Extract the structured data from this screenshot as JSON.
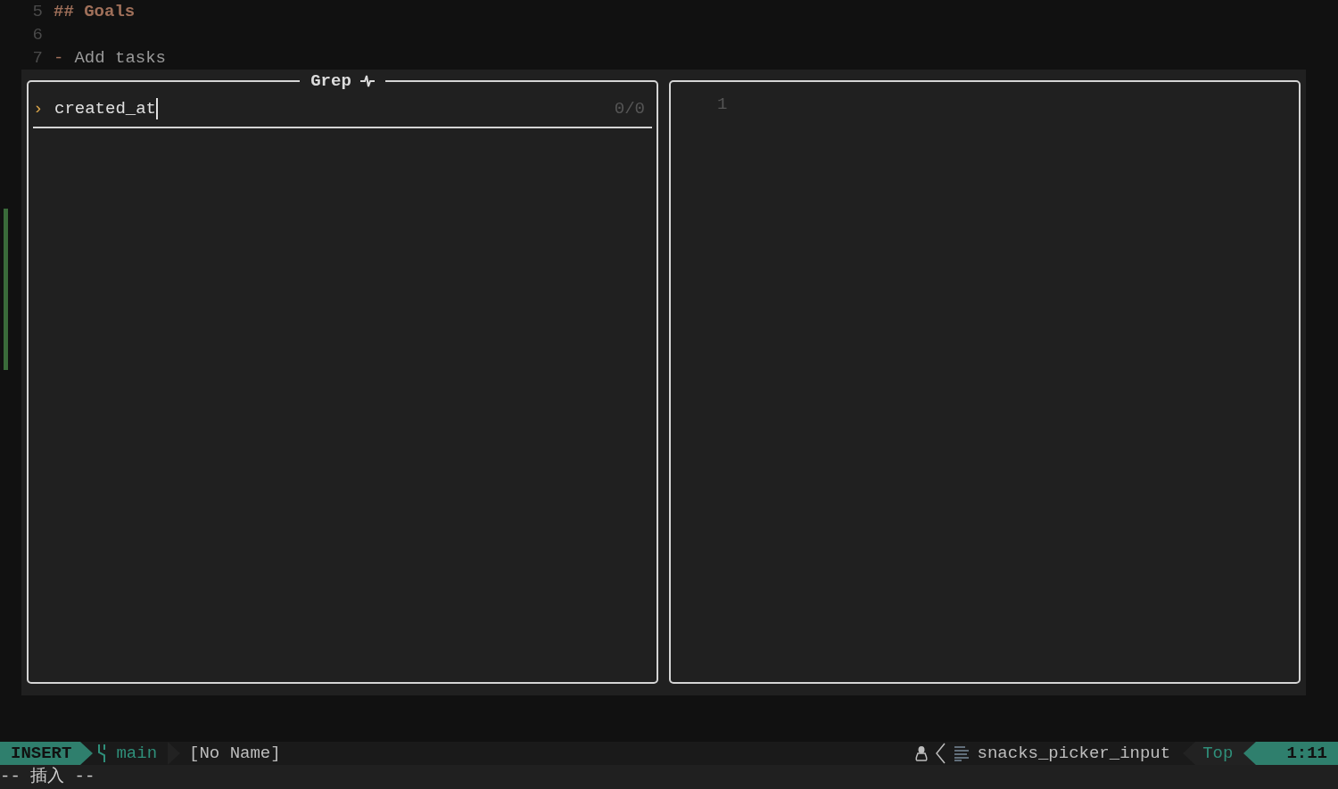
{
  "editor": {
    "lines": [
      {
        "number": "5",
        "kind": "heading",
        "text": "## Goals"
      },
      {
        "number": "6",
        "kind": "blank"
      },
      {
        "number": "7",
        "kind": "list",
        "marker": "-",
        "text": "Add tasks"
      }
    ]
  },
  "picker": {
    "title": "Grep",
    "input": {
      "prompt": "›",
      "value": "created_at",
      "count": "0/0"
    },
    "preview": {
      "lines": [
        "1"
      ]
    }
  },
  "status_bar": {
    "mode": "INSERT",
    "branch": "main",
    "file": "[No Name]",
    "filetype": "snacks_picker_input",
    "position": "Top",
    "cursor": "1:11"
  },
  "command_line": "-- 插入 --"
}
